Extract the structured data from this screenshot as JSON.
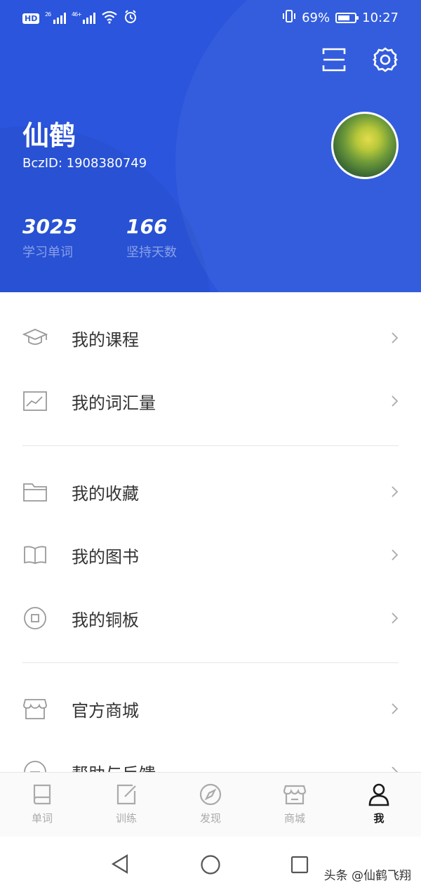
{
  "status_bar": {
    "hd": "HD",
    "net_1": "26",
    "net_2": "46+",
    "battery": "69%",
    "time": "10:27"
  },
  "profile": {
    "name": "仙鹤",
    "bcz_id": "BczID: 1908380749",
    "stats": [
      {
        "value": "3025",
        "label": "学习单词"
      },
      {
        "value": "166",
        "label": "坚持天数"
      }
    ]
  },
  "menu": {
    "items": [
      {
        "label": "我的课程",
        "icon": "graduation-cap-icon"
      },
      {
        "label": "我的词汇量",
        "icon": "chart-icon"
      },
      {
        "label": "我的收藏",
        "icon": "folder-icon"
      },
      {
        "label": "我的图书",
        "icon": "book-open-icon"
      },
      {
        "label": "我的铜板",
        "icon": "coin-icon"
      },
      {
        "label": "官方商城",
        "icon": "store-icon"
      },
      {
        "label": "帮助与反馈",
        "icon": "help-icon"
      }
    ]
  },
  "tabbar": {
    "tabs": [
      {
        "label": "单词",
        "icon": "book-icon"
      },
      {
        "label": "训练",
        "icon": "edit-icon"
      },
      {
        "label": "发现",
        "icon": "compass-icon"
      },
      {
        "label": "商城",
        "icon": "store-icon"
      },
      {
        "label": "我",
        "icon": "user-icon",
        "active": true
      }
    ]
  },
  "watermark": "头条 @仙鹤飞翔",
  "colors": {
    "header_bg": "#2a55dc",
    "text_primary": "#333333",
    "tab_inactive": "#aaaaaa",
    "tab_active": "#1a1a1a"
  }
}
